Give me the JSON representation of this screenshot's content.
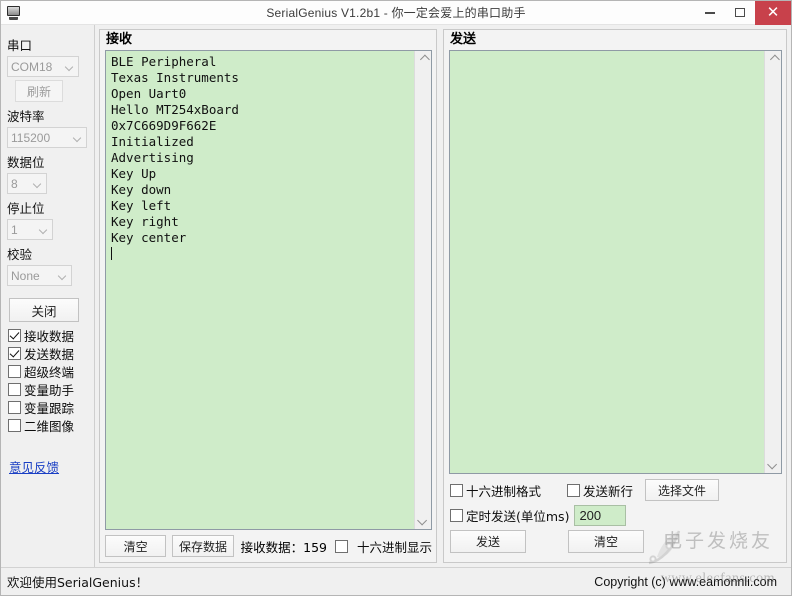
{
  "window": {
    "title": "SerialGenius V1.2b1 - 你一定会爱上的串口助手",
    "icon": "monitor-icon",
    "minimize_label": "−",
    "maximize_label": "□",
    "close_label": "✕",
    "close_color": "#c8414b"
  },
  "sidebar": {
    "port": {
      "label": "串口",
      "value": "COM18",
      "options": [
        "COM18"
      ]
    },
    "refresh_label": "刷新",
    "baud": {
      "label": "波特率",
      "value": "115200",
      "options": [
        "115200"
      ]
    },
    "databits": {
      "label": "数据位",
      "value": "8",
      "options": [
        "8"
      ]
    },
    "stopbits": {
      "label": "停止位",
      "value": "1",
      "options": [
        "1"
      ]
    },
    "parity": {
      "label": "校验",
      "value": "None",
      "options": [
        "None"
      ]
    },
    "close_port_label": "关闭",
    "checkboxes": [
      {
        "label": "接收数据",
        "checked": true
      },
      {
        "label": "发送数据",
        "checked": true
      },
      {
        "label": "超级终端",
        "checked": false
      },
      {
        "label": "变量助手",
        "checked": false
      },
      {
        "label": "变量跟踪",
        "checked": false
      },
      {
        "label": "二维图像",
        "checked": false
      }
    ],
    "feedback_link": "意见反馈"
  },
  "receive": {
    "title": "接收",
    "text": "BLE Peripheral\nTexas Instruments\nOpen Uart0\nHello MT254xBoard\n0x7C669D9F662E\nInitialized\nAdvertising\nKey Up\nKey down\nKey left\nKey right\nKey center\n",
    "background_color": "#cfecc9",
    "clear_label": "清空",
    "save_label": "保存数据",
    "count_label": "接收数据：159",
    "hex_display": {
      "label": "十六进制显示",
      "checked": false
    }
  },
  "send": {
    "title": "发送",
    "text": "",
    "background_color": "#cfecc9",
    "hex_format": {
      "label": "十六进制格式",
      "checked": false
    },
    "send_newline": {
      "label": "发送新行",
      "checked": false
    },
    "choose_file_label": "选择文件",
    "timed_send": {
      "label": "定时发送(单位ms)",
      "checked": false
    },
    "interval_value": "200",
    "send_label": "发送",
    "clear_label": "清空"
  },
  "statusbar": {
    "left": "欢迎使用SerialGenius！",
    "right": "Copyright (c) www.eamonnli.com"
  },
  "watermark": {
    "cn_text": "电子发烧友",
    "url_text": "www.elecfans.com"
  }
}
